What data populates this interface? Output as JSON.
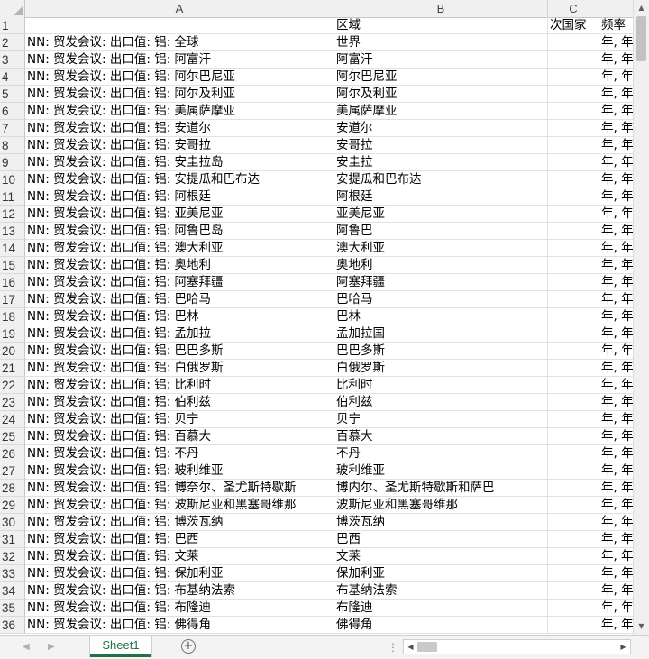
{
  "columns": [
    "A",
    "B",
    "C",
    ""
  ],
  "header_row": {
    "num": "1",
    "a": "",
    "b": "区域",
    "c": "次国家",
    "d": "频率"
  },
  "rows": [
    {
      "num": "2",
      "a": "NN: 贸发会议: 出口值: 铝: 全球",
      "b": "世界",
      "c": "",
      "d": "年, 年"
    },
    {
      "num": "3",
      "a": "NN: 贸发会议: 出口值: 铝: 阿富汗",
      "b": "阿富汗",
      "c": "",
      "d": "年, 年"
    },
    {
      "num": "4",
      "a": "NN: 贸发会议: 出口值: 铝: 阿尔巴尼亚",
      "b": "阿尔巴尼亚",
      "c": "",
      "d": "年, 年"
    },
    {
      "num": "5",
      "a": "NN: 贸发会议: 出口值: 铝: 阿尔及利亚",
      "b": "阿尔及利亚",
      "c": "",
      "d": "年, 年"
    },
    {
      "num": "6",
      "a": "NN: 贸发会议: 出口值: 铝: 美属萨摩亚",
      "b": "美属萨摩亚",
      "c": "",
      "d": "年, 年"
    },
    {
      "num": "7",
      "a": "NN: 贸发会议: 出口值: 铝: 安道尔",
      "b": "安道尔",
      "c": "",
      "d": "年, 年"
    },
    {
      "num": "8",
      "a": "NN: 贸发会议: 出口值: 铝: 安哥拉",
      "b": "安哥拉",
      "c": "",
      "d": "年, 年"
    },
    {
      "num": "9",
      "a": "NN: 贸发会议: 出口值: 铝: 安圭拉岛",
      "b": "安圭拉",
      "c": "",
      "d": "年, 年"
    },
    {
      "num": "10",
      "a": "NN: 贸发会议: 出口值: 铝: 安提瓜和巴布达",
      "b": "安提瓜和巴布达",
      "c": "",
      "d": "年, 年"
    },
    {
      "num": "11",
      "a": "NN: 贸发会议: 出口值: 铝: 阿根廷",
      "b": "阿根廷",
      "c": "",
      "d": "年, 年"
    },
    {
      "num": "12",
      "a": "NN: 贸发会议: 出口值: 铝: 亚美尼亚",
      "b": "亚美尼亚",
      "c": "",
      "d": "年, 年"
    },
    {
      "num": "13",
      "a": "NN: 贸发会议: 出口值: 铝: 阿鲁巴岛",
      "b": "阿鲁巴",
      "c": "",
      "d": "年, 年"
    },
    {
      "num": "14",
      "a": "NN: 贸发会议: 出口值: 铝: 澳大利亚",
      "b": "澳大利亚",
      "c": "",
      "d": "年, 年"
    },
    {
      "num": "15",
      "a": "NN: 贸发会议: 出口值: 铝: 奥地利",
      "b": "奥地利",
      "c": "",
      "d": "年, 年"
    },
    {
      "num": "16",
      "a": "NN: 贸发会议: 出口值: 铝: 阿塞拜疆",
      "b": "阿塞拜疆",
      "c": "",
      "d": "年, 年"
    },
    {
      "num": "17",
      "a": "NN: 贸发会议: 出口值: 铝: 巴哈马",
      "b": "巴哈马",
      "c": "",
      "d": "年, 年"
    },
    {
      "num": "18",
      "a": "NN: 贸发会议: 出口值: 铝: 巴林",
      "b": "巴林",
      "c": "",
      "d": "年, 年"
    },
    {
      "num": "19",
      "a": "NN: 贸发会议: 出口值: 铝: 孟加拉",
      "b": "孟加拉国",
      "c": "",
      "d": "年, 年"
    },
    {
      "num": "20",
      "a": "NN: 贸发会议: 出口值: 铝: 巴巴多斯",
      "b": "巴巴多斯",
      "c": "",
      "d": "年, 年"
    },
    {
      "num": "21",
      "a": "NN: 贸发会议: 出口值: 铝: 白俄罗斯",
      "b": "白俄罗斯",
      "c": "",
      "d": "年, 年"
    },
    {
      "num": "22",
      "a": "NN: 贸发会议: 出口值: 铝: 比利时",
      "b": "比利时",
      "c": "",
      "d": "年, 年"
    },
    {
      "num": "23",
      "a": "NN: 贸发会议: 出口值: 铝: 伯利兹",
      "b": "伯利兹",
      "c": "",
      "d": "年, 年"
    },
    {
      "num": "24",
      "a": "NN: 贸发会议: 出口值: 铝: 贝宁",
      "b": "贝宁",
      "c": "",
      "d": "年, 年"
    },
    {
      "num": "25",
      "a": "NN: 贸发会议: 出口值: 铝: 百慕大",
      "b": "百慕大",
      "c": "",
      "d": "年, 年"
    },
    {
      "num": "26",
      "a": "NN: 贸发会议: 出口值: 铝: 不丹",
      "b": "不丹",
      "c": "",
      "d": "年, 年"
    },
    {
      "num": "27",
      "a": "NN: 贸发会议: 出口值: 铝: 玻利维亚",
      "b": "玻利维亚",
      "c": "",
      "d": "年, 年"
    },
    {
      "num": "28",
      "a": "NN: 贸发会议: 出口值: 铝: 博奈尔、圣尤斯特歇斯",
      "b": "博内尔、圣尤斯特歇斯和萨巴",
      "c": "",
      "d": "年, 年"
    },
    {
      "num": "29",
      "a": "NN: 贸发会议: 出口值: 铝: 波斯尼亚和黑塞哥维那",
      "b": "波斯尼亚和黑塞哥维那",
      "c": "",
      "d": "年, 年"
    },
    {
      "num": "30",
      "a": "NN: 贸发会议: 出口值: 铝: 博茨瓦纳",
      "b": "博茨瓦纳",
      "c": "",
      "d": "年, 年"
    },
    {
      "num": "31",
      "a": "NN: 贸发会议: 出口值: 铝: 巴西",
      "b": "巴西",
      "c": "",
      "d": "年, 年"
    },
    {
      "num": "32",
      "a": "NN: 贸发会议: 出口值: 铝: 文莱",
      "b": "文莱",
      "c": "",
      "d": "年, 年"
    },
    {
      "num": "33",
      "a": "NN: 贸发会议: 出口值: 铝: 保加利亚",
      "b": "保加利亚",
      "c": "",
      "d": "年, 年"
    },
    {
      "num": "34",
      "a": "NN: 贸发会议: 出口值: 铝: 布基纳法索",
      "b": "布基纳法索",
      "c": "",
      "d": "年, 年"
    },
    {
      "num": "35",
      "a": "NN: 贸发会议: 出口值: 铝: 布隆迪",
      "b": "布隆迪",
      "c": "",
      "d": "年, 年"
    },
    {
      "num": "36",
      "a": "NN: 贸发会议: 出口值: 铝: 佛得角",
      "b": "佛得角",
      "c": "",
      "d": "年, 年"
    }
  ],
  "sheet_tab": {
    "label": "Sheet1"
  },
  "add_sheet": {
    "label": "+"
  },
  "icons": {
    "scroll_up": "▲",
    "scroll_down": "▼",
    "scroll_left": "◀",
    "scroll_right": "▶",
    "nav_left": "◀",
    "nav_right": "▶",
    "split_dots": "⋮"
  },
  "colors": {
    "accent": "#217346"
  }
}
